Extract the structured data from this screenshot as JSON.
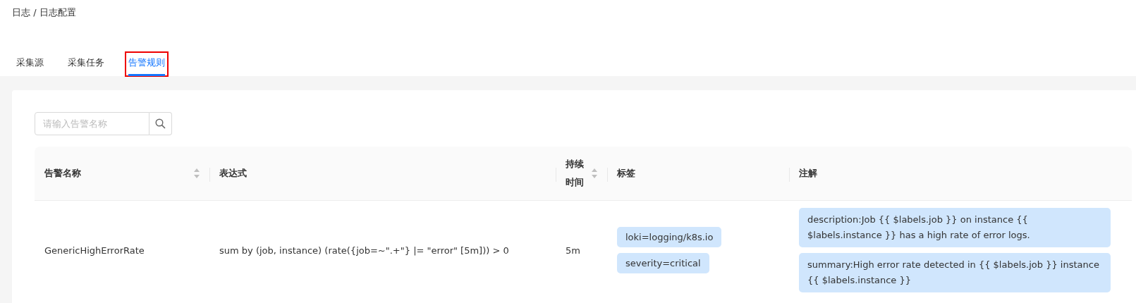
{
  "breadcrumb": "日志 / 日志配置",
  "tabs": [
    {
      "label": "采集源",
      "selected": false,
      "highlighted": false
    },
    {
      "label": "采集任务",
      "selected": false,
      "highlighted": false
    },
    {
      "label": "告警规则",
      "selected": true,
      "highlighted": true
    }
  ],
  "search": {
    "placeholder": "请输入告警名称"
  },
  "table": {
    "columns": [
      {
        "label": "告警名称",
        "sortable": true
      },
      {
        "label": "表达式",
        "sortable": false
      },
      {
        "label": "持续时间",
        "sortable": true
      },
      {
        "label": "标签",
        "sortable": false
      },
      {
        "label": "注解",
        "sortable": false
      }
    ],
    "rows": [
      {
        "name": "GenericHighErrorRate",
        "expression": "sum by (job, instance) (rate({job=~\".+\"} |= \"error\" [5m])) > 0",
        "duration": "5m",
        "tags": [
          "loki=logging/k8s.io",
          "severity=critical"
        ],
        "annotations": [
          "description:Job {{ $labels.job }} on instance {{ $labels.instance }} has a high rate of error logs.",
          "summary:High error rate detected in {{ $labels.job }} instance {{ $labels.instance }}"
        ]
      }
    ]
  }
}
